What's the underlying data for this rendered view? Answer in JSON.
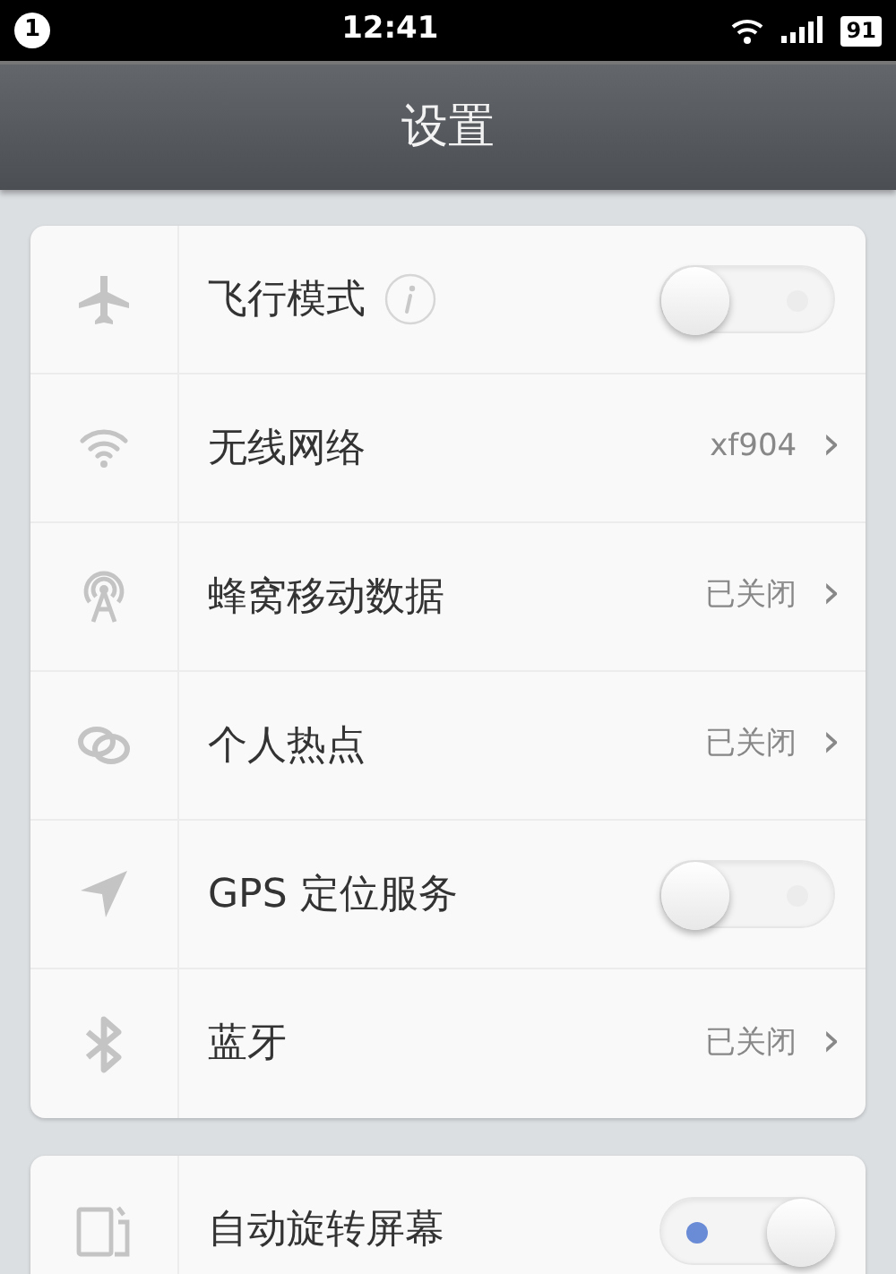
{
  "status_bar": {
    "notification_count": "1",
    "time": "12:41",
    "battery": "91"
  },
  "nav_bar": {
    "title": "设置"
  },
  "sections": [
    {
      "rows": [
        {
          "kind": "toggle",
          "label": "飞行模式",
          "info": true,
          "on": false
        },
        {
          "kind": "link",
          "label": "无线网络",
          "value": "xf904",
          "chevron": "›"
        },
        {
          "kind": "link",
          "label": "蜂窝移动数据",
          "value": "已关闭",
          "chevron": "›"
        },
        {
          "kind": "link",
          "label": "个人热点",
          "value": "已关闭",
          "chevron": "›"
        },
        {
          "kind": "toggle",
          "label": "GPS 定位服务",
          "on": false
        },
        {
          "kind": "link",
          "label": "蓝牙",
          "value": "已关闭",
          "chevron": "›"
        }
      ]
    },
    {
      "rows": [
        {
          "kind": "toggle",
          "label": "自动旋转屏幕",
          "on": true
        }
      ]
    }
  ]
}
